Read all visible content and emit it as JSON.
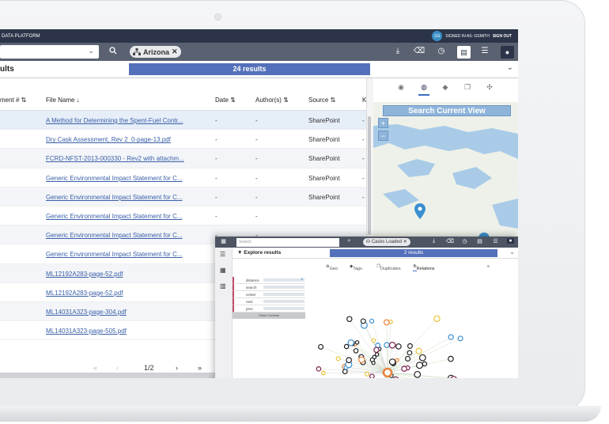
{
  "app": {
    "title": "DATA PLATFORM",
    "user_initials": "GS",
    "signed_in": "SIGNED IN AS: GSMITH",
    "sign_out": "SIGN OUT"
  },
  "toolbar": {
    "filter_chip": "Arizona",
    "icons": [
      "search-icon",
      "upload-icon",
      "eraser-icon",
      "history-icon",
      "save-icon",
      "list-icon",
      "user-icon"
    ]
  },
  "results": {
    "title": "ults",
    "count_label": "24 results"
  },
  "table": {
    "columns": [
      "ment # ⇅",
      "File Name ↓",
      "Date ⇅",
      "Author(s) ⇅",
      "Source ⇅",
      "K"
    ],
    "rows": [
      {
        "name": "A Method for Determining the Spent-Fuel Contr...",
        "date": "-",
        "author": "-",
        "source": "SharePoint",
        "k": "-"
      },
      {
        "name": "Dry Cask Assessment, Rev 2_0-page-13.pdf",
        "date": "-",
        "author": "-",
        "source": "SharePoint",
        "k": "-"
      },
      {
        "name": "FCRD-NFST-2013-000330 - Rev2 with attachm...",
        "date": "-",
        "author": "-",
        "source": "SharePoint",
        "k": "-"
      },
      {
        "name": "Generic Environmental Impact Statement for C...",
        "date": "-",
        "author": "-",
        "source": "SharePoint",
        "k": "-"
      },
      {
        "name": "Generic Environmental Impact Statement for C...",
        "date": "-",
        "author": "-",
        "source": "SharePoint",
        "k": "-"
      },
      {
        "name": "Generic Environmental Impact Statement for C...",
        "date": "-",
        "author": "-",
        "source": "",
        "k": ""
      },
      {
        "name": "Generic Environmental Impact Statement for C...",
        "date": "-",
        "author": "-",
        "source": "",
        "k": ""
      },
      {
        "name": "Generic Environmental Impact Statement for C...",
        "date": "-",
        "author": "-",
        "source": "",
        "k": ""
      },
      {
        "name": "ML12192A283-page-52.pdf",
        "date": "-",
        "author": "-",
        "source": "",
        "k": ""
      },
      {
        "name": "ML12192A283-page-52.pdf",
        "date": "-",
        "author": "-",
        "source": "",
        "k": ""
      },
      {
        "name": "ML14031A323-page-304.pdf",
        "date": "-",
        "author": "-",
        "source": "",
        "k": ""
      },
      {
        "name": "ML14031A323-page-505.pdf",
        "date": "-",
        "author": "-",
        "source": "",
        "k": ""
      }
    ]
  },
  "pager": {
    "first": "«",
    "prev": "‹",
    "page": "1/2",
    "next": "›",
    "last": "»"
  },
  "map": {
    "search_label": "Search Current View",
    "zoom_in": "+",
    "zoom_out": "−"
  },
  "inset": {
    "search_placeholder": "Search",
    "chip": "Casks Loaded",
    "explore_title": "▼ Explore results",
    "count_label": "2 results",
    "tabs": [
      "Geo",
      "Tags",
      "Duplicates",
      "Relations",
      "s"
    ],
    "controls": [
      {
        "label": "distance",
        "value": "0"
      },
      {
        "label": "search",
        "value": ""
      },
      {
        "label": "center",
        "value": ""
      },
      {
        "label": "next",
        "value": ""
      },
      {
        "label": "prev",
        "value": ""
      }
    ],
    "close_controls": "Close Controls"
  }
}
